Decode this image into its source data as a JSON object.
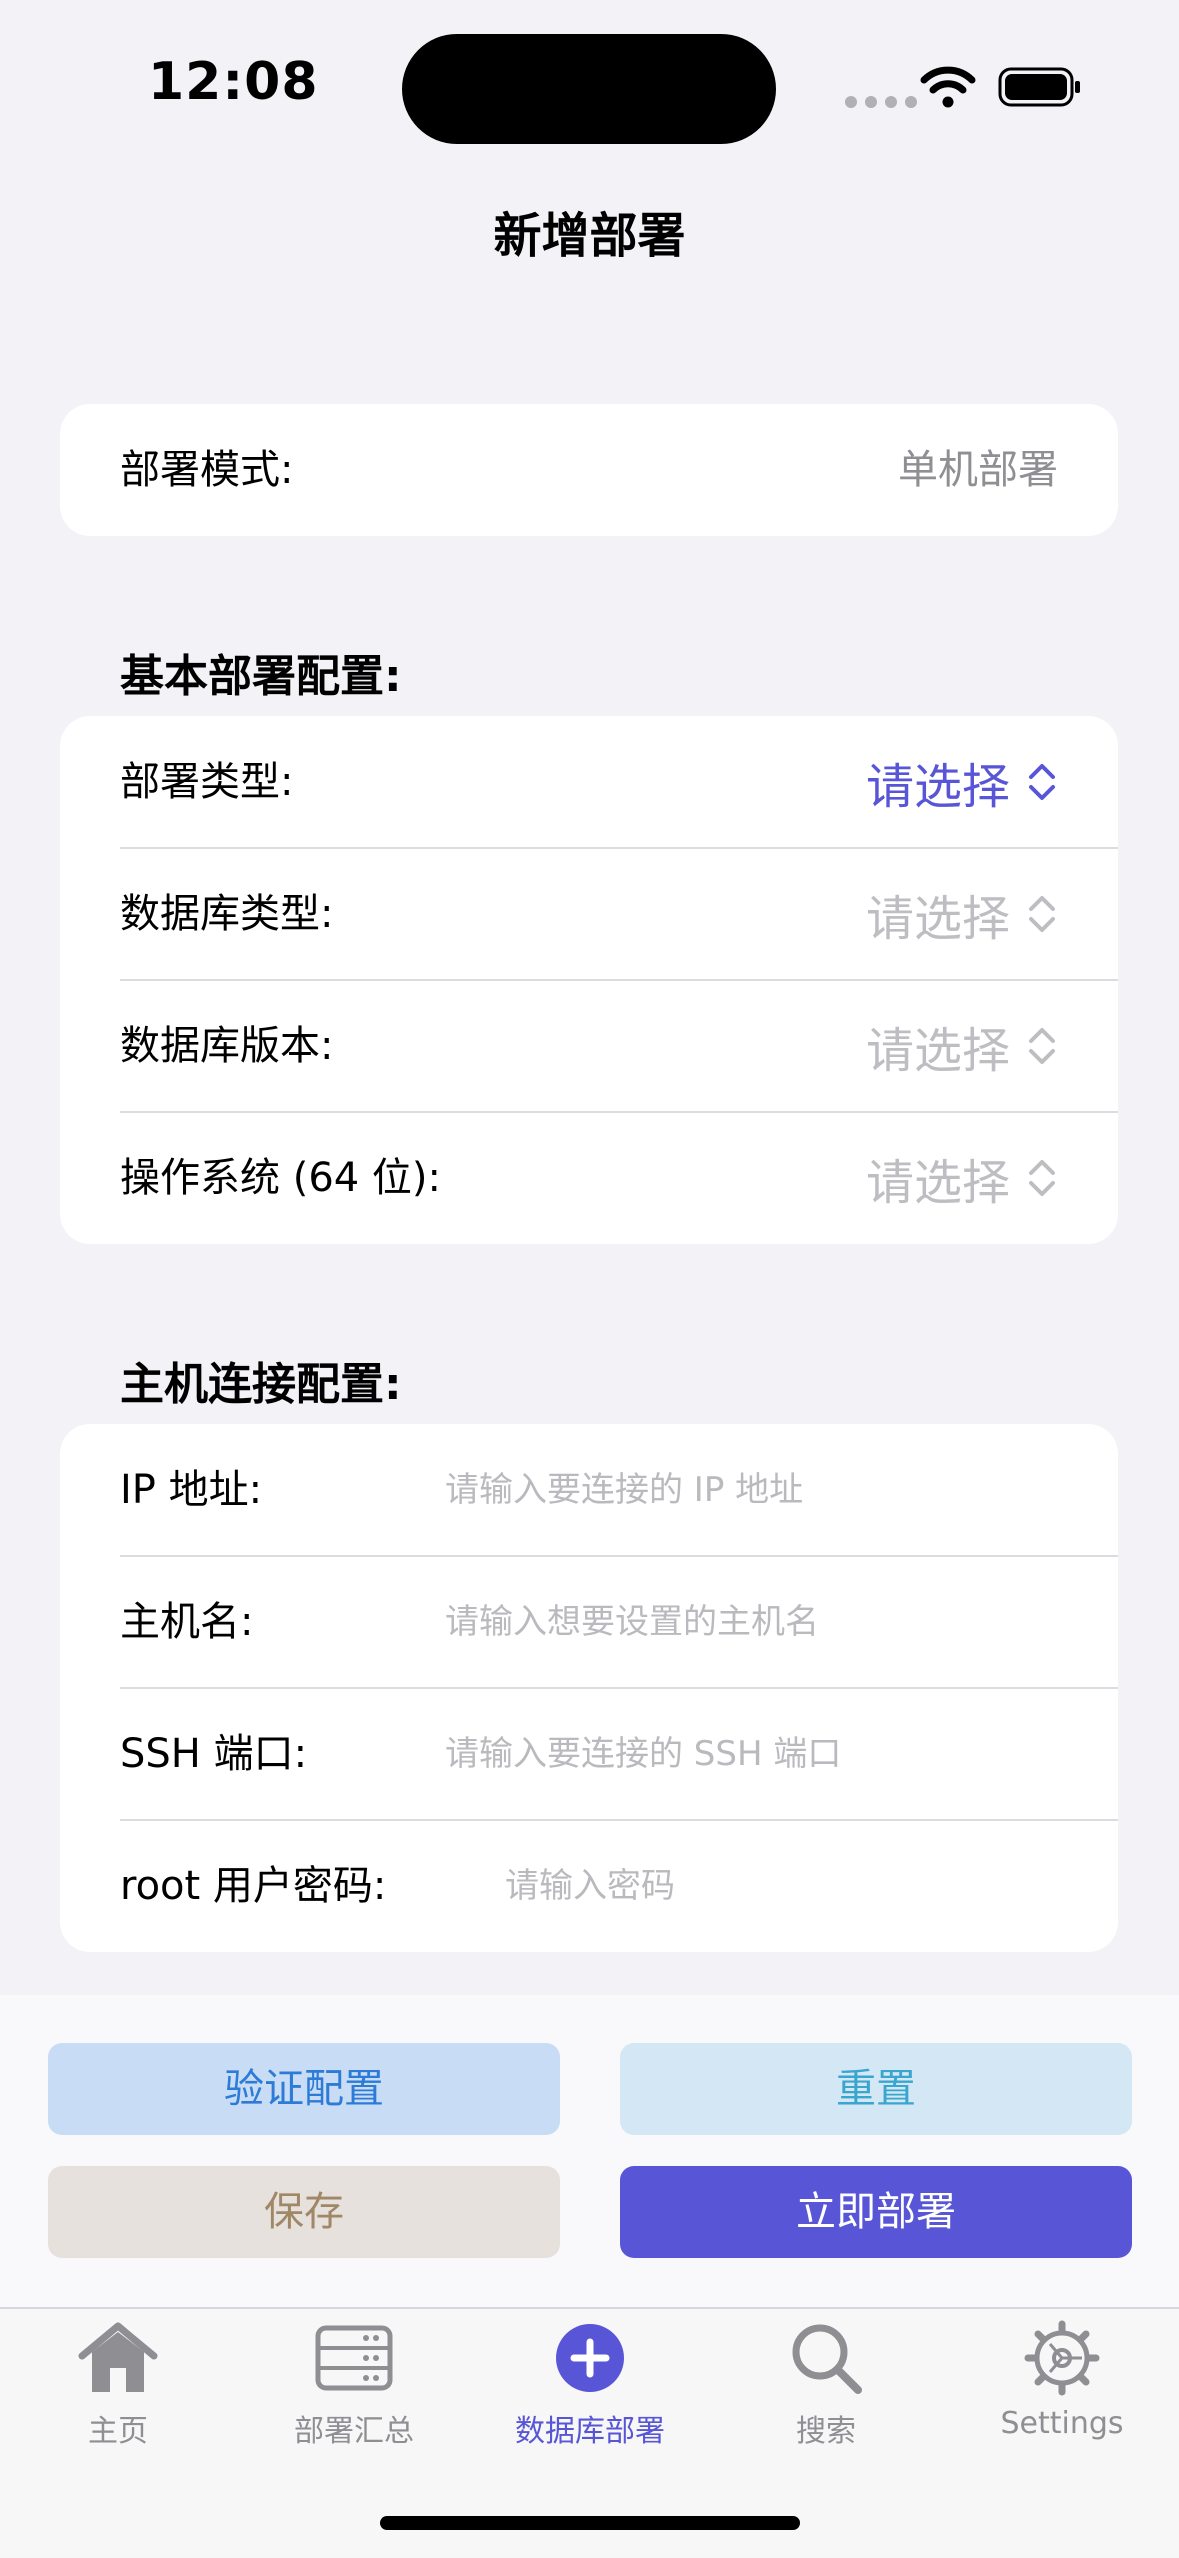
{
  "status_bar": {
    "time": "12:08"
  },
  "nav": {
    "title": "新增部署"
  },
  "mode_card": {
    "label": "部署模式:",
    "value": "单机部署"
  },
  "basic_section": {
    "header": "基本部署配置:",
    "rows": [
      {
        "label": "部署类型:",
        "picker": "请选择",
        "active": true
      },
      {
        "label": "数据库类型:",
        "picker": "请选择",
        "active": false
      },
      {
        "label": "数据库版本:",
        "picker": "请选择",
        "active": false
      },
      {
        "label": "操作系统 (64 位):",
        "picker": "请选择",
        "active": false
      }
    ]
  },
  "host_section": {
    "header": "主机连接配置:",
    "rows": [
      {
        "label": "IP 地址:",
        "placeholder": "请输入要连接的 IP 地址"
      },
      {
        "label": "主机名:",
        "placeholder": "请输入想要设置的主机名"
      },
      {
        "label": "SSH 端口:",
        "placeholder": "请输入要连接的 SSH 端口"
      },
      {
        "label": "root 用户密码:",
        "placeholder": "请输入密码"
      }
    ]
  },
  "actions": {
    "verify": "验证配置",
    "reset": "重置",
    "save": "保存",
    "deploy": "立即部署"
  },
  "tabbar": {
    "items": [
      {
        "label": "主页",
        "icon": "house-icon"
      },
      {
        "label": "部署汇总",
        "icon": "server-icon"
      },
      {
        "label": "数据库部署",
        "icon": "plus-circle-icon",
        "active": true
      },
      {
        "label": "搜索",
        "icon": "magnifier-icon"
      },
      {
        "label": "Settings",
        "icon": "gear-icon"
      }
    ]
  },
  "colors": {
    "accent": "#5856d6",
    "placeholder": "#b9b9be",
    "background": "#f2f2f7"
  }
}
